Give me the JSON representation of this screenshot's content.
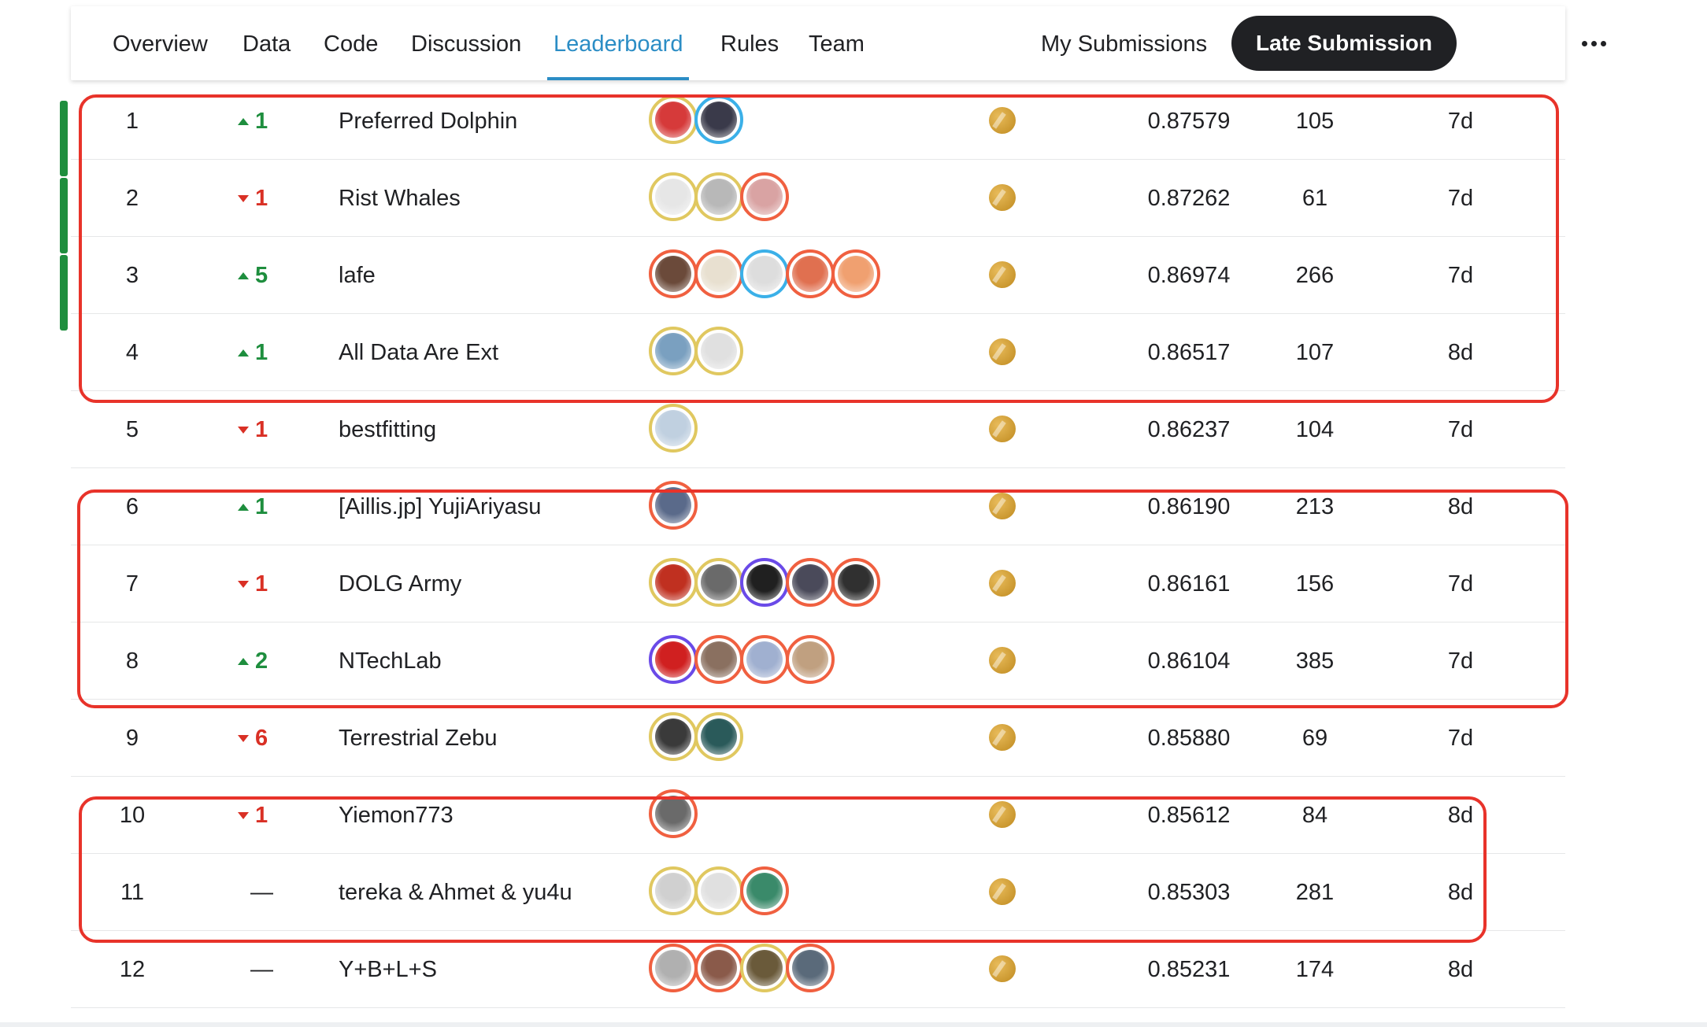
{
  "nav": {
    "tabs": [
      {
        "label": "Overview",
        "active": false
      },
      {
        "label": "Data",
        "active": false
      },
      {
        "label": "Code",
        "active": false
      },
      {
        "label": "Discussion",
        "active": false
      },
      {
        "label": "Leaderboard",
        "active": true
      },
      {
        "label": "Rules",
        "active": false
      },
      {
        "label": "Team",
        "active": false
      }
    ],
    "my_submissions": "My Submissions",
    "late_submission": "Late Submission",
    "more_icon": "more-horizontal-icon"
  },
  "colors": {
    "accent": "#2b8dc5",
    "up": "#1e8e3e",
    "down": "#d93025",
    "highlight": "#e8332a",
    "medal": "#c9952b"
  },
  "leaderboard": [
    {
      "rank": "1",
      "delta": "1",
      "dir": "up",
      "team": "Preferred Dolphin",
      "avatars": [
        "#d63a3a",
        "#3a3a4a"
      ],
      "rings": [
        "#e0c860",
        "#3bb0e8"
      ],
      "score": "0.87579",
      "entries": "105",
      "last": "7d"
    },
    {
      "rank": "2",
      "delta": "1",
      "dir": "down",
      "team": "Rist Whales",
      "avatars": [
        "#e6e6e6",
        "#b8b8b8",
        "#d9a3a3"
      ],
      "rings": [
        "#e0c860",
        "#e0c860",
        "#f06040"
      ],
      "score": "0.87262",
      "entries": "61",
      "last": "7d"
    },
    {
      "rank": "3",
      "delta": "5",
      "dir": "up",
      "team": "lafe",
      "avatars": [
        "#6b4a3a",
        "#e8e0d0",
        "#dddddd",
        "#e07050",
        "#f0a070"
      ],
      "rings": [
        "#f06040",
        "#f06040",
        "#3bb0e8",
        "#f06040",
        "#f06040"
      ],
      "score": "0.86974",
      "entries": "266",
      "last": "7d"
    },
    {
      "rank": "4",
      "delta": "1",
      "dir": "up",
      "team": "All Data Are Ext",
      "avatars": [
        "#7aa0c0",
        "#e0e0e0"
      ],
      "rings": [
        "#e0c860",
        "#e0c860"
      ],
      "score": "0.86517",
      "entries": "107",
      "last": "8d"
    },
    {
      "rank": "5",
      "delta": "1",
      "dir": "down",
      "team": "bestfitting",
      "avatars": [
        "#c0d0e0"
      ],
      "rings": [
        "#e0c860"
      ],
      "score": "0.86237",
      "entries": "104",
      "last": "7d"
    },
    {
      "rank": "6",
      "delta": "1",
      "dir": "up",
      "team": "[Aillis.jp] YujiAriyasu",
      "avatars": [
        "#5a6a8a"
      ],
      "rings": [
        "#f06040"
      ],
      "score": "0.86190",
      "entries": "213",
      "last": "8d"
    },
    {
      "rank": "7",
      "delta": "1",
      "dir": "down",
      "team": "DOLG Army",
      "avatars": [
        "#c03020",
        "#6a6a6a",
        "#202020",
        "#4a4a5a",
        "#303030"
      ],
      "rings": [
        "#e0c860",
        "#e0c860",
        "#6a4ae8",
        "#f06040",
        "#f06040"
      ],
      "score": "0.86161",
      "entries": "156",
      "last": "7d"
    },
    {
      "rank": "8",
      "delta": "2",
      "dir": "up",
      "team": "NTechLab",
      "avatars": [
        "#d02020",
        "#8a7060",
        "#a0b0d0",
        "#c0a080"
      ],
      "rings": [
        "#6a4ae8",
        "#f06040",
        "#f06040",
        "#f06040"
      ],
      "score": "0.86104",
      "entries": "385",
      "last": "7d"
    },
    {
      "rank": "9",
      "delta": "6",
      "dir": "down",
      "team": "Terrestrial Zebu",
      "avatars": [
        "#3a3a3a",
        "#2a5a5a"
      ],
      "rings": [
        "#e0c860",
        "#e0c860"
      ],
      "score": "0.85880",
      "entries": "69",
      "last": "7d"
    },
    {
      "rank": "10",
      "delta": "1",
      "dir": "down",
      "team": "Yiemon773",
      "avatars": [
        "#6a6a6a"
      ],
      "rings": [
        "#f06040"
      ],
      "score": "0.85612",
      "entries": "84",
      "last": "8d"
    },
    {
      "rank": "11",
      "delta": "—",
      "dir": "none",
      "team": "tereka & Ahmet & yu4u",
      "avatars": [
        "#d0d0d0",
        "#e0e0e0",
        "#3a8a6a"
      ],
      "rings": [
        "#e0c860",
        "#e0c860",
        "#f06040"
      ],
      "score": "0.85303",
      "entries": "281",
      "last": "8d"
    },
    {
      "rank": "12",
      "delta": "—",
      "dir": "none",
      "team": "Y+B+L+S",
      "avatars": [
        "#b0b0b0",
        "#8a5a4a",
        "#6a5a3a",
        "#5a6a7a"
      ],
      "rings": [
        "#f06040",
        "#f06040",
        "#e0c860",
        "#f06040"
      ],
      "score": "0.85231",
      "entries": "174",
      "last": "8d"
    }
  ]
}
